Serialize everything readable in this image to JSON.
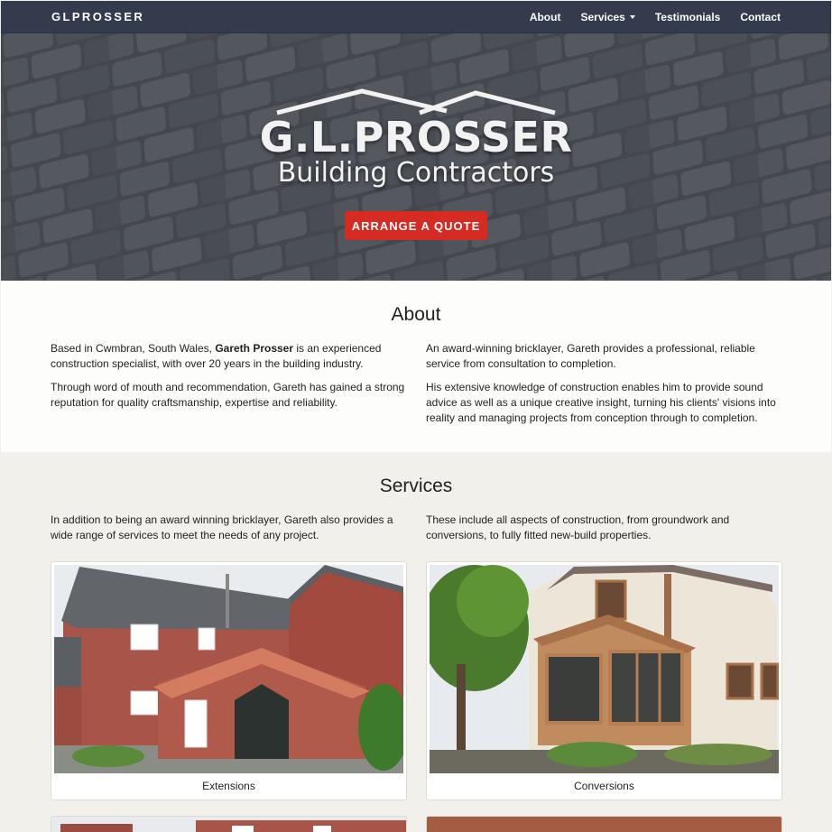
{
  "nav": {
    "brand": "GLPROSSER",
    "links": [
      "About",
      "Services",
      "Testimonials",
      "Contact"
    ]
  },
  "hero": {
    "title": "G.L.PROSSER",
    "subtitle": "Building Contractors",
    "cta": "ARRANGE A QUOTE"
  },
  "about": {
    "title": "About",
    "left_p1_pre": "Based in Cwmbran, South Wales, ",
    "left_p1_bold": "Gareth Prosser",
    "left_p1_post": " is an experienced construction specialist, with over 20 years in the building industry.",
    "left_p2": "Through word of mouth and recommendation, Gareth has gained a strong reputation for quality craftsmanship, expertise and reliability.",
    "right_p1": "An award-winning bricklayer, Gareth provides a professional, reliable service from consultation to completion.",
    "right_p2": "His extensive knowledge of construction enables him to provide sound advice as well as a unique creative insight, turning his clients' visions into reality and managing projects from conception through to completion."
  },
  "services": {
    "title": "Services",
    "left_intro": "In addition to being an award winning bricklayer, Gareth also provides a wide range of services to meet the needs of any project.",
    "right_intro": "These include all aspects of construction, from groundwork and conversions, to fully fitted new-build properties.",
    "cards": [
      "Extensions",
      "Conversions"
    ]
  },
  "colors": {
    "navbar": "#333b4d",
    "accent": "#d52b22",
    "services_bg": "#f1f0ea"
  }
}
